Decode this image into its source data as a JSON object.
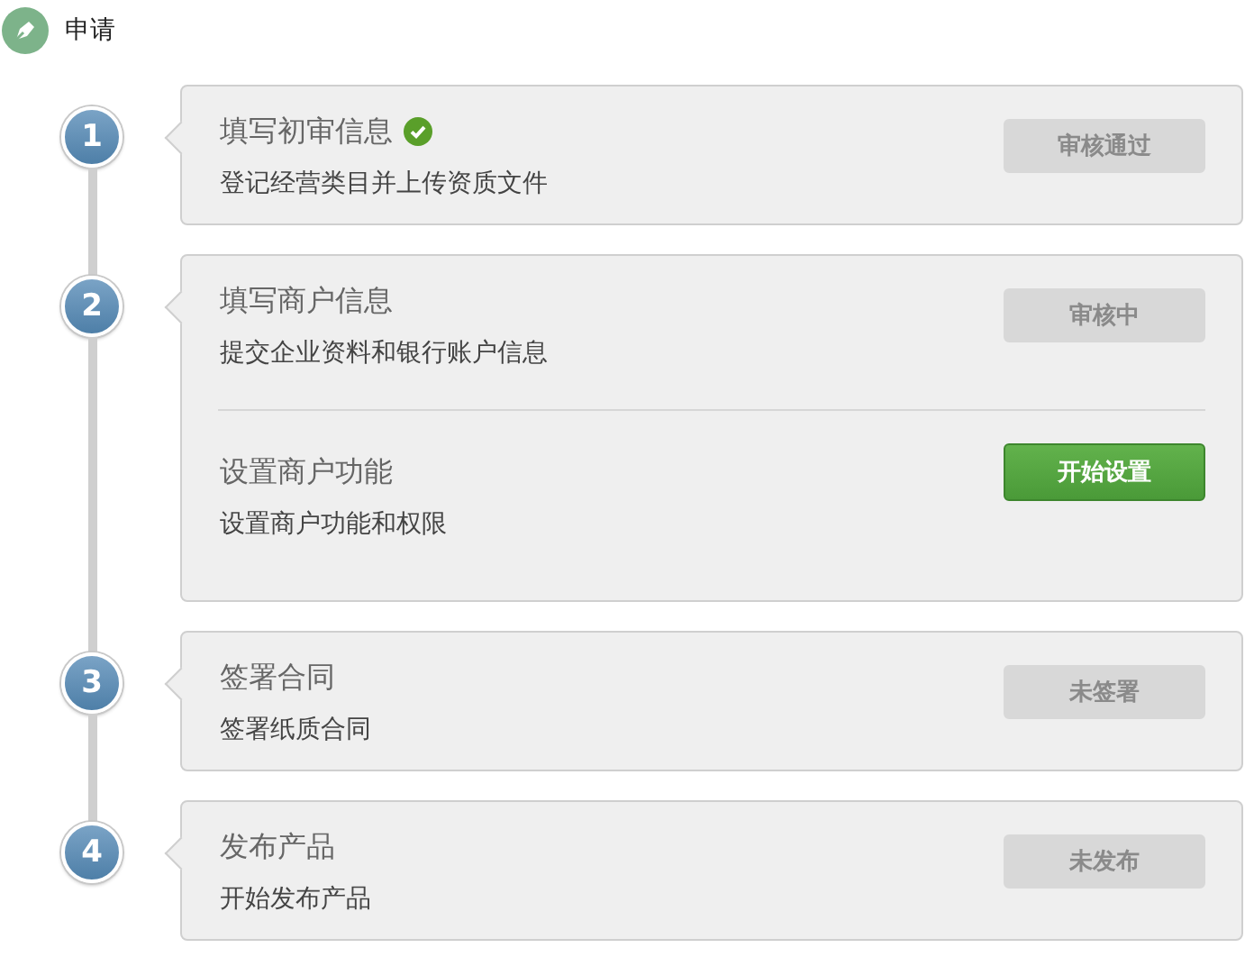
{
  "header": {
    "title": "申请"
  },
  "steps": [
    {
      "number": "1",
      "tasks": [
        {
          "title": "填写初审信息",
          "done": true,
          "description": "登记经营类目并上传资质文件",
          "button": {
            "label": "审核通过",
            "disabled": true
          }
        }
      ]
    },
    {
      "number": "2",
      "tasks": [
        {
          "title": "填写商户信息",
          "done": false,
          "description": "提交企业资料和银行账户信息",
          "button": {
            "label": "审核中",
            "disabled": true
          }
        },
        {
          "title": "设置商户功能",
          "done": false,
          "description": "设置商户功能和权限",
          "button": {
            "label": "开始设置",
            "disabled": false
          }
        }
      ]
    },
    {
      "number": "3",
      "tasks": [
        {
          "title": "签署合同",
          "done": false,
          "description": "签署纸质合同",
          "button": {
            "label": "未签署",
            "disabled": true
          }
        }
      ]
    },
    {
      "number": "4",
      "tasks": [
        {
          "title": "发布产品",
          "done": false,
          "description": "开始发布产品",
          "button": {
            "label": "未发布",
            "disabled": true
          }
        }
      ]
    }
  ]
}
